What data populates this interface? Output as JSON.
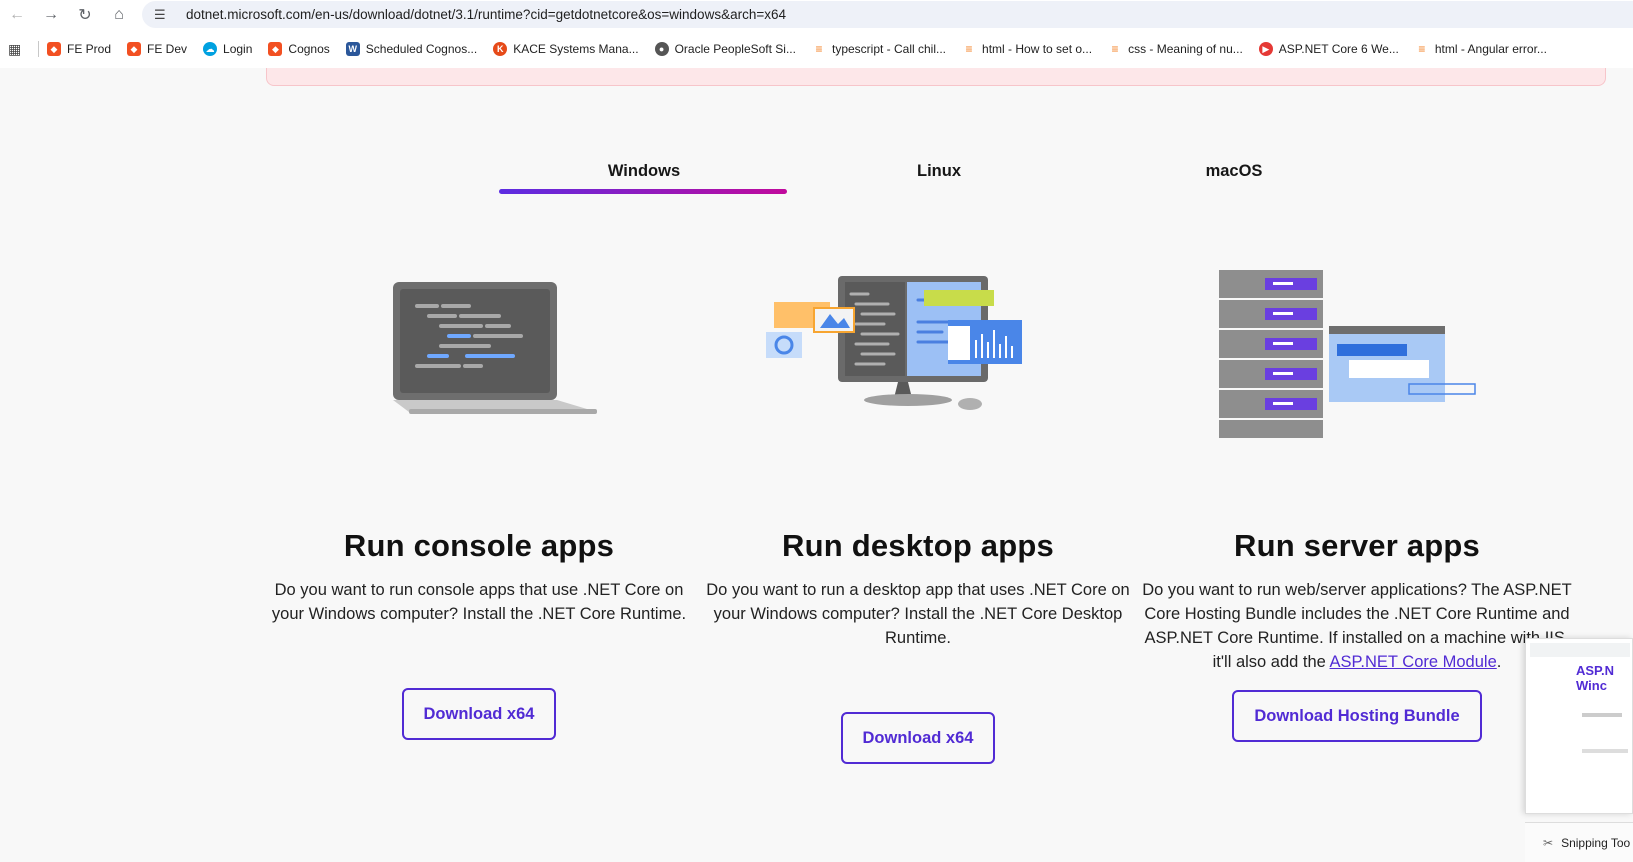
{
  "browser": {
    "url": "dotnet.microsoft.com/en-us/download/dotnet/3.1/runtime?cid=getdotnetcore&os=windows&arch=x64",
    "bookmarks": [
      {
        "label": "FE Prod",
        "color": "#f25022"
      },
      {
        "label": "FE Dev",
        "color": "#f25022"
      },
      {
        "label": "Login",
        "color": "#00a1e0"
      },
      {
        "label": "Cognos",
        "color": "#f25022"
      },
      {
        "label": "Scheduled Cognos...",
        "color": "#2b579a"
      },
      {
        "label": "KACE Systems Mana...",
        "color": "#e64a19"
      },
      {
        "label": "Oracle PeopleSoft Si...",
        "color": "#555555"
      },
      {
        "label": "typescript - Call chil...",
        "color": "#f48024"
      },
      {
        "label": "html - How to set o...",
        "color": "#f48024"
      },
      {
        "label": "css - Meaning of nu...",
        "color": "#f48024"
      },
      {
        "label": "ASP.NET Core 6 We...",
        "color": "#e53935"
      },
      {
        "label": "html - Angular error...",
        "color": "#f48024"
      }
    ]
  },
  "tabs": [
    {
      "label": "Windows",
      "active": true
    },
    {
      "label": "Linux",
      "active": false
    },
    {
      "label": "macOS",
      "active": false
    }
  ],
  "columns": [
    {
      "title": "Run console apps",
      "text": "Do you want to run console apps that use .NET Core on your Windows computer? Install the .NET Core Runtime.",
      "button": "Download x64"
    },
    {
      "title": "Run desktop apps",
      "text": "Do you want to run a desktop app that uses .NET Core on your Windows computer? Install the .NET Core Desktop Runtime.",
      "button": "Download x64"
    },
    {
      "title": "Run server apps",
      "text_before_link": "Do you want to run web/server applications? The ASP.NET Core Hosting Bundle includes the .NET Core Runtime and ASP.NET Core Runtime. If installed on a machine with IIS, it'll also add the ",
      "link": "ASP.NET Core Module",
      "text_after_link": ".",
      "button": "Download Hosting Bundle"
    }
  ],
  "snipping_tool": {
    "label": "Snipping Too",
    "preview_text": "ASP.N Winc"
  },
  "colors": {
    "accent": "#512bd4",
    "gradient_end": "#c10a9c"
  }
}
